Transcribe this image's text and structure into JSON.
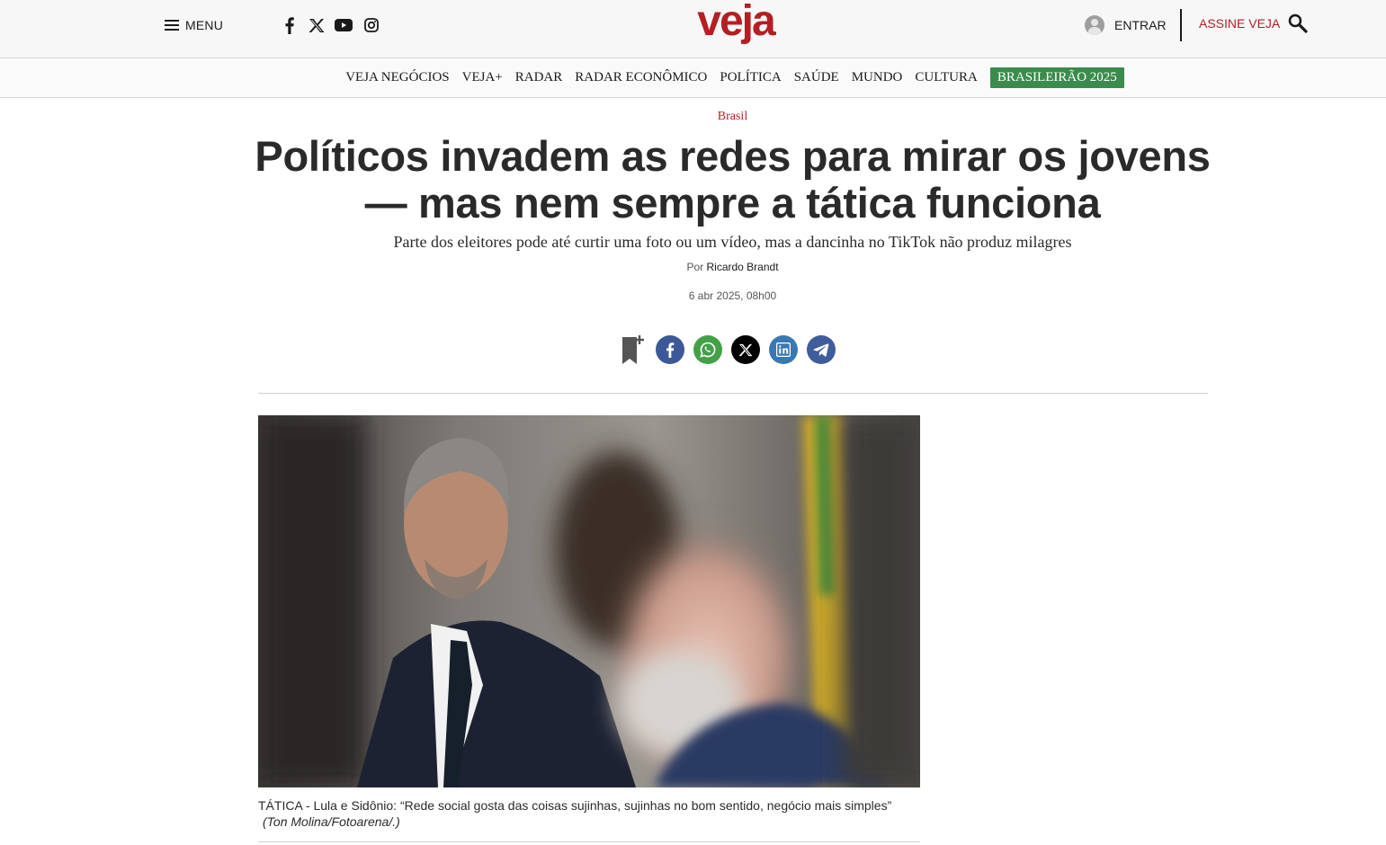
{
  "header": {
    "menu_label": "MENU",
    "social_icons": [
      "facebook-icon",
      "x-icon",
      "youtube-icon",
      "instagram-icon"
    ],
    "logo_text": "veja",
    "login_label": "ENTRAR",
    "subscribe_label": "ASSINE VEJA",
    "brand_color": "#b41f24"
  },
  "nav": {
    "items": [
      "VEJA NEGÓCIOS",
      "VEJA+",
      "RADAR",
      "RADAR ECONÔMICO",
      "POLÍTICA",
      "SAÚDE",
      "MUNDO",
      "CULTURA",
      "BRASILEIRÃO 2025"
    ],
    "highlight_color": "#3a8c4c"
  },
  "article": {
    "category": "Brasil",
    "headline": "Políticos invadem as redes para mirar os jovens — mas nem sempre a tática funciona",
    "subheadline": "Parte dos eleitores pode até curtir uma foto ou um vídeo, mas a dancinha no TikTok não produz milagres",
    "byline_prefix": "Por",
    "author": "Ricardo Brandt",
    "date": "6 abr 2025, 08h00",
    "share_icons": [
      "bookmark-add-icon",
      "facebook-icon",
      "whatsapp-icon",
      "x-icon",
      "linkedin-icon",
      "telegram-icon"
    ],
    "photo": {
      "caption": "TÁTICA -  Lula e Sidônio: “Rede social gosta das coisas sujinhas, sujinhas no bom sentido, negócio mais simples”",
      "credit": "(Ton Molina/Fotoarena/.)"
    }
  }
}
